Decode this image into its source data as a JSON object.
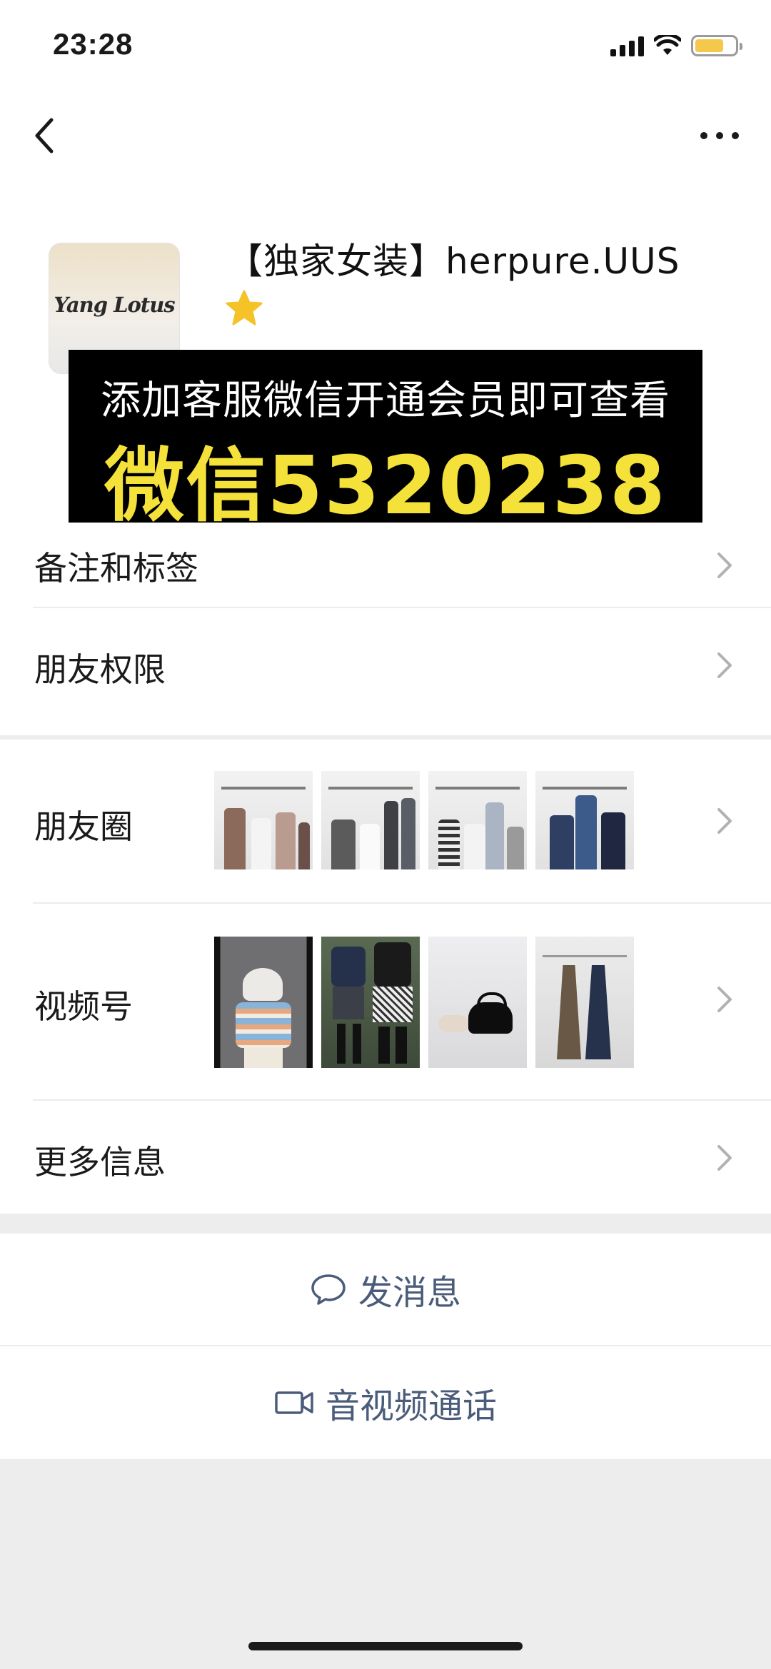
{
  "status": {
    "time": "23:28",
    "battery_color": "#f3c84b"
  },
  "nav": {
    "back_icon": "chevron-left-icon",
    "more_icon": "more-dots-icon"
  },
  "profile": {
    "name": "【独家女装】herpure.UUS",
    "avatar_text": "Yang Lotus",
    "star_color": "#f5c228"
  },
  "banner": {
    "line1": "添加客服微信开通会员即可查看",
    "line2": "微信5320238",
    "highlight_color": "#f4e13a"
  },
  "rows": {
    "remarks": "备注和标签",
    "permissions": "朋友权限",
    "moments": "朋友圈",
    "channels": "视频号",
    "more_info": "更多信息"
  },
  "actions": {
    "message": "发消息",
    "call": "音视频通话"
  },
  "colors": {
    "action_text": "#4b5c7a",
    "background": "#ededed"
  }
}
